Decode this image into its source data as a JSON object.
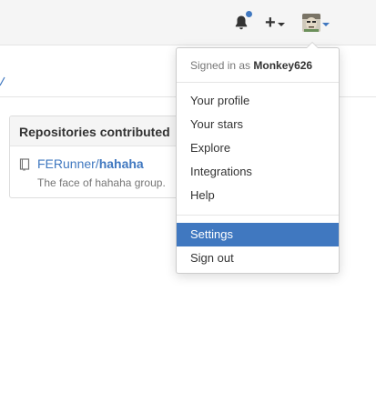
{
  "header": {
    "notification_icon": "bell-icon",
    "create_icon": "plus-icon",
    "create_label": "+",
    "avatar_alt": "Monkey626 avatar"
  },
  "profile": {
    "contributions_panel": {
      "title": "Repositories contributed",
      "repos": [
        {
          "owner": "FERunner",
          "separator": "/",
          "name": "hahaha",
          "description": "The face of hahaha group."
        }
      ]
    }
  },
  "user_menu": {
    "signed_in_prefix": "Signed in as ",
    "username": "Monkey626",
    "items": [
      {
        "label": "Your profile"
      },
      {
        "label": "Your stars"
      },
      {
        "label": "Explore"
      },
      {
        "label": "Integrations"
      },
      {
        "label": "Help"
      },
      {
        "label": "Settings",
        "active": true
      },
      {
        "label": "Sign out"
      }
    ]
  },
  "colors": {
    "accent": "#4078c0",
    "header_bg": "#f5f5f5",
    "muted_text": "#767676"
  }
}
